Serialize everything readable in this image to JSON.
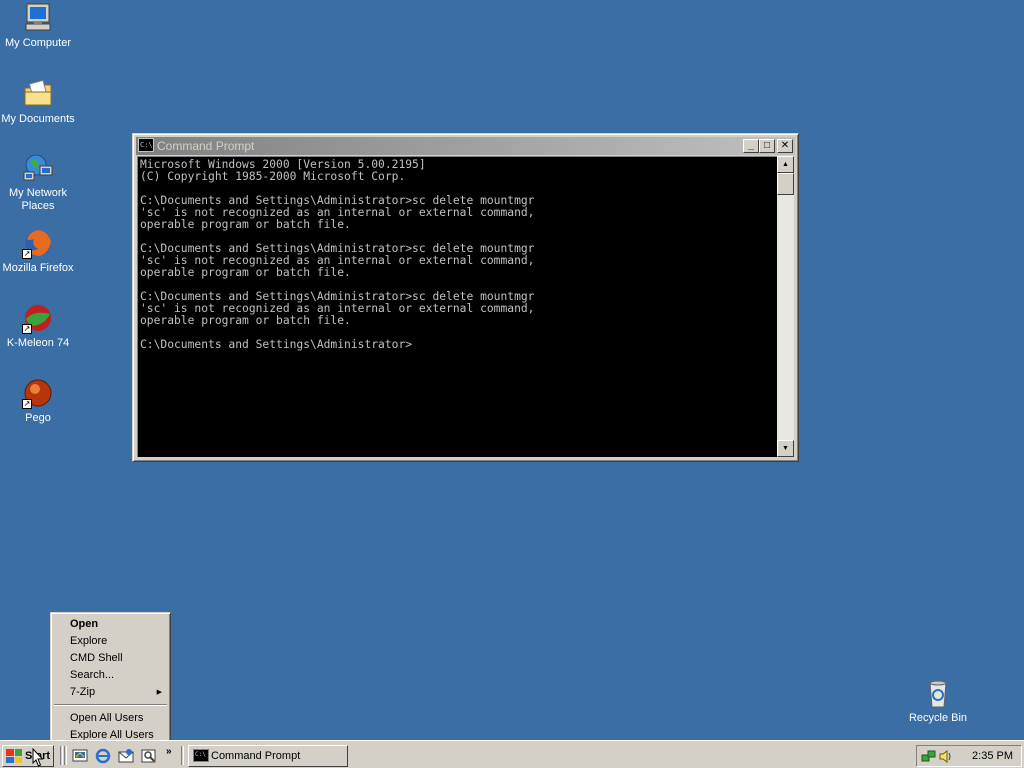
{
  "desktop": {
    "icons": [
      {
        "label": "My Computer",
        "icon": "computer-icon"
      },
      {
        "label": "My Documents",
        "icon": "folder-documents-icon"
      },
      {
        "label": "My Network Places",
        "icon": "network-icon"
      },
      {
        "label": "Mozilla Firefox",
        "icon": "firefox-icon"
      },
      {
        "label": "K-Meleon 74",
        "icon": "k-meleon-icon"
      },
      {
        "label": "Pego",
        "icon": "pego-icon"
      },
      {
        "label": "Recycle Bin",
        "icon": "recycle-bin-icon"
      }
    ],
    "background_color": "#3a6ea5"
  },
  "window": {
    "title": "Command Prompt",
    "icon_text": "C:\\",
    "controls": {
      "minimize": "_",
      "maximize": "□",
      "close": "✕"
    },
    "console_lines": [
      "Microsoft Windows 2000 [Version 5.00.2195]",
      "(C) Copyright 1985-2000 Microsoft Corp.",
      "",
      "C:\\Documents and Settings\\Administrator>sc delete mountmgr",
      "'sc' is not recognized as an internal or external command,",
      "operable program or batch file.",
      "",
      "C:\\Documents and Settings\\Administrator>sc delete mountmgr",
      "'sc' is not recognized as an internal or external command,",
      "operable program or batch file.",
      "",
      "C:\\Documents and Settings\\Administrator>sc delete mountmgr",
      "'sc' is not recognized as an internal or external command,",
      "operable program or batch file.",
      "",
      "C:\\Documents and Settings\\Administrator>"
    ]
  },
  "context_menu": {
    "items": [
      {
        "label": "Open",
        "bold": true
      },
      {
        "label": "Explore"
      },
      {
        "label": "CMD Shell"
      },
      {
        "label": "Search..."
      },
      {
        "label": "7-Zip",
        "submenu": true
      },
      {
        "separator": true
      },
      {
        "label": "Open All Users"
      },
      {
        "label": "Explore All Users"
      }
    ]
  },
  "taskbar": {
    "start_label": "Start",
    "quick_launch": [
      "show-desktop-icon",
      "internet-explorer-icon",
      "outlook-express-icon",
      "search-icon"
    ],
    "overflow": "»",
    "tasks": [
      {
        "label": "Command Prompt",
        "icon_text": "C:\\"
      }
    ],
    "tray_icons": [
      "network-tray-icon",
      "volume-tray-icon"
    ],
    "clock": "2:35 PM"
  }
}
